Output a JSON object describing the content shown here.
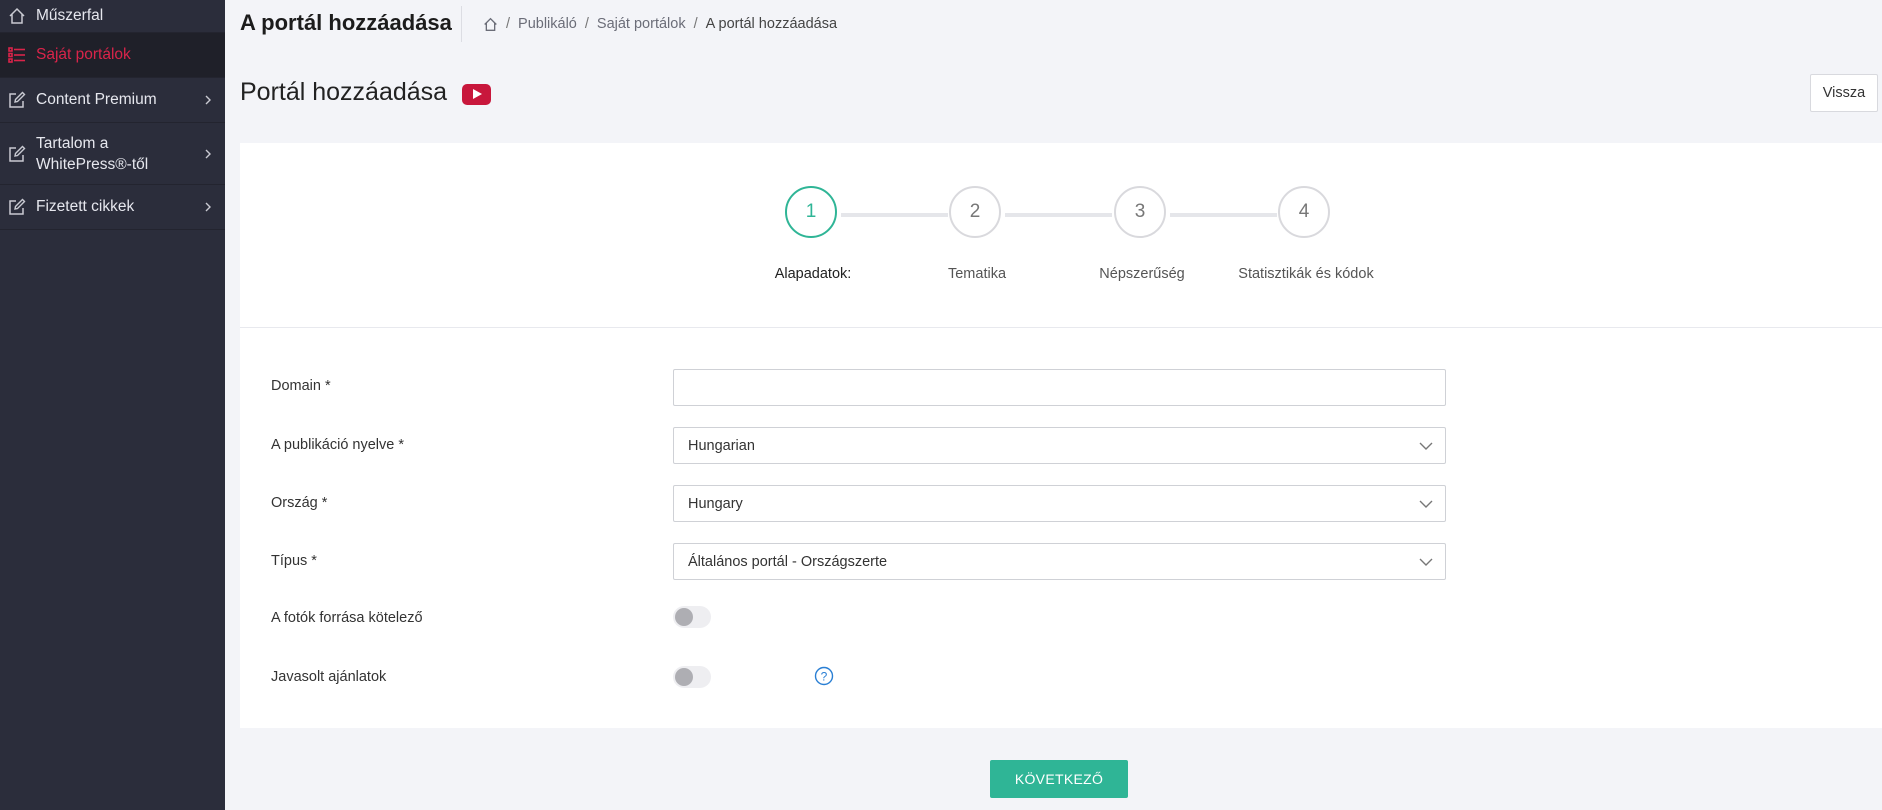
{
  "sidebar": {
    "items": [
      {
        "label": "Műszerfal",
        "icon": "home-icon"
      },
      {
        "label": "Saját portálok",
        "icon": "list-icon",
        "active": true
      },
      {
        "label": "Content Premium",
        "icon": "edit-icon"
      },
      {
        "label": "Tartalom a WhitePress®-től",
        "icon": "edit-icon"
      },
      {
        "label": "Fizetett cikkek",
        "icon": "edit-icon"
      }
    ]
  },
  "header": {
    "title": "A portál hozzáadása",
    "breadcrumb": [
      "Publikáló",
      "Saját portálok",
      "A portál hozzáadása"
    ]
  },
  "page": {
    "title": "Portál hozzáadása",
    "back_label": "Vissza"
  },
  "stepper": {
    "steps": [
      {
        "number": "1",
        "label": "Alapadatok:",
        "active": true
      },
      {
        "number": "2",
        "label": "Tematika"
      },
      {
        "number": "3",
        "label": "Népszerűség"
      },
      {
        "number": "4",
        "label": "Statisztikák és kódok"
      }
    ]
  },
  "form": {
    "domain": {
      "label": "Domain *",
      "value": ""
    },
    "language": {
      "label": "A publikáció nyelve *",
      "value": "Hungarian"
    },
    "country": {
      "label": "Ország *",
      "value": "Hungary"
    },
    "type": {
      "label": "Típus *",
      "value": "Általános portál - Országszerte"
    },
    "photo_source": {
      "label": "A fotók forrása kötelező",
      "on": false
    },
    "suggested_offers": {
      "label": "Javasolt ajánlatok",
      "on": false
    }
  },
  "actions": {
    "next_label": "KÖVETKEZŐ"
  },
  "colors": {
    "accent": "#2fb596",
    "sidebar_bg": "#2b2d3b",
    "active_red": "#d9244a",
    "youtube": "#c8173c"
  }
}
